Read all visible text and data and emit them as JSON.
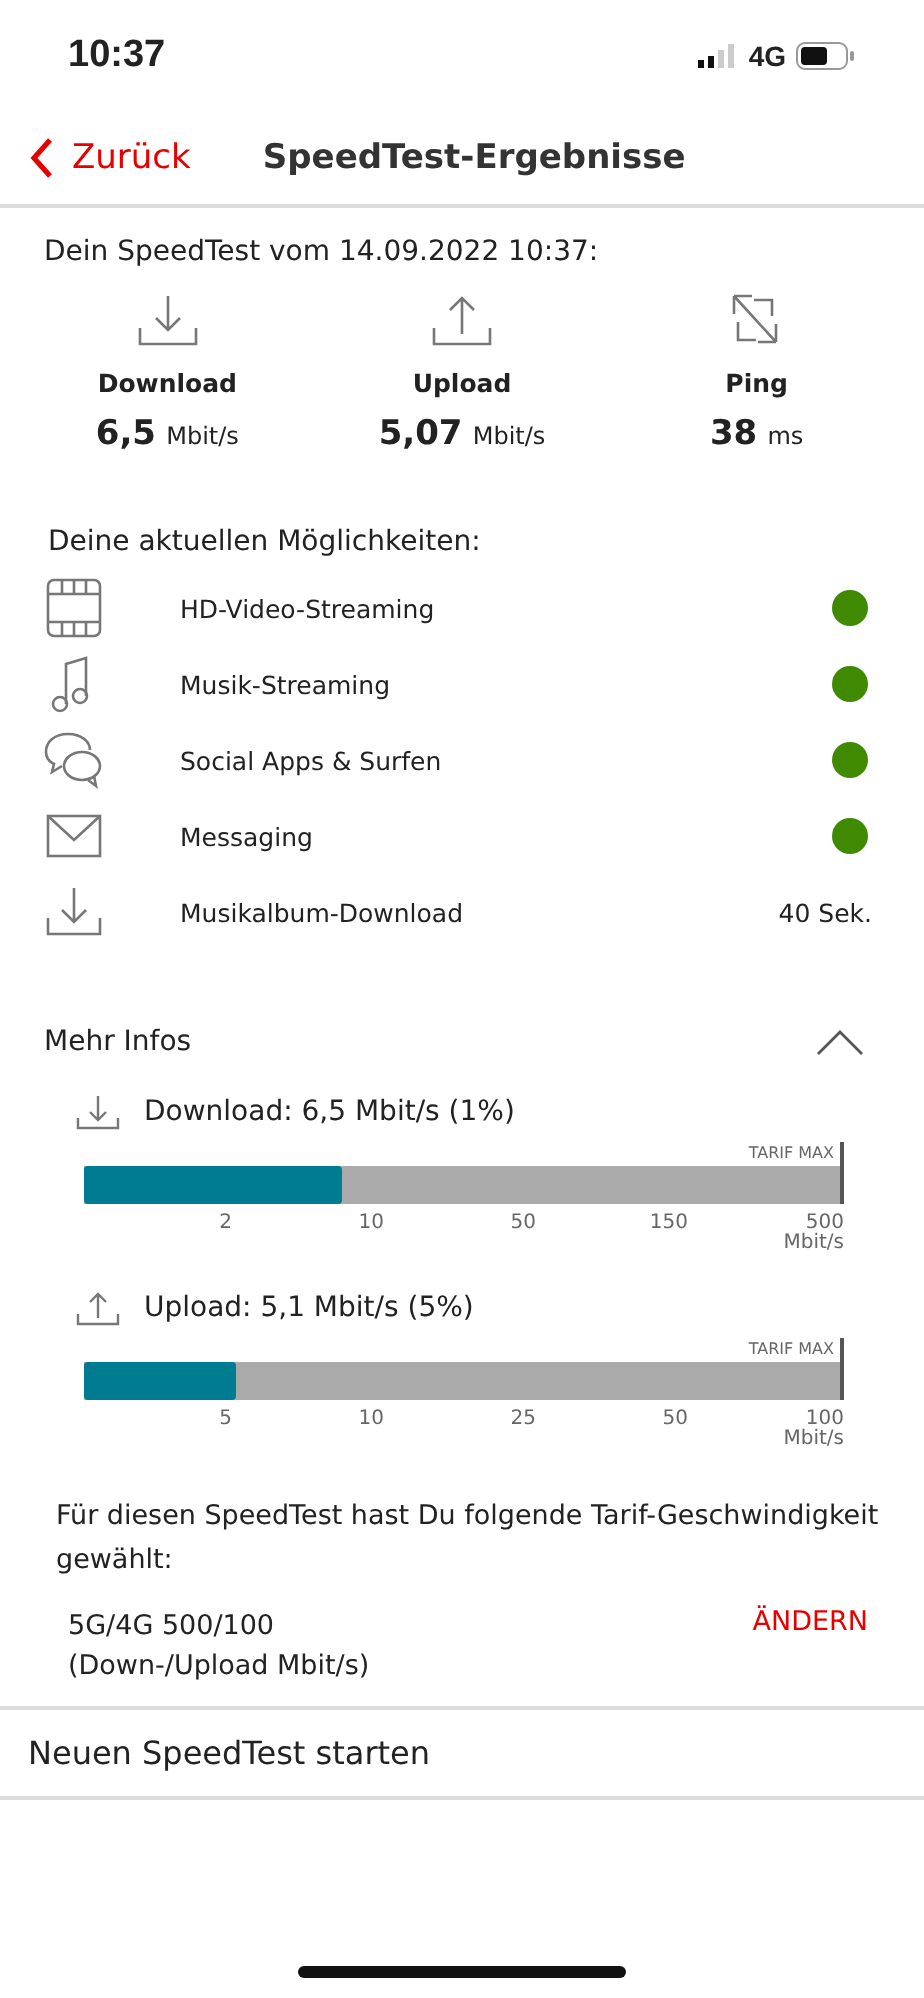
{
  "status_bar": {
    "time": "10:37",
    "network": "4G"
  },
  "nav": {
    "back": "Zurück",
    "title": "SpeedTest-Ergebnisse"
  },
  "summary": {
    "heading": "Dein SpeedTest vom 14.09.2022 10:37:",
    "metrics": [
      {
        "kind": "download",
        "label": "Download",
        "value": "6,5",
        "unit": "Mbit/s"
      },
      {
        "kind": "upload",
        "label": "Upload",
        "value": "5,07",
        "unit": "Mbit/s"
      },
      {
        "kind": "ping",
        "label": "Ping",
        "value": "38",
        "unit": "ms"
      }
    ]
  },
  "possibilities": {
    "heading": "Deine aktuellen Möglichkeiten:",
    "items": [
      {
        "kind": "video",
        "label": "HD-Video-Streaming",
        "color": "#3f8a00"
      },
      {
        "kind": "music",
        "label": "Musik-Streaming",
        "color": "#3f8a00"
      },
      {
        "kind": "chat",
        "label": "Social Apps & Surfen",
        "color": "#3f8a00"
      },
      {
        "kind": "mail",
        "label": "Messaging",
        "color": "#3f8a00"
      },
      {
        "kind": "download",
        "label": "Musikalbum-Download",
        "value": "40 Sek."
      }
    ]
  },
  "more_info": {
    "title": "Mehr Infos",
    "expanded": true,
    "bars": [
      {
        "kind": "download",
        "label": "Download: 6,5 Mbit/s (1%)",
        "max_label": "TARIF MAX",
        "level": 0.34,
        "ticks": [
          "2",
          "10",
          "50",
          "150",
          "500"
        ],
        "unit": "Mbit/s"
      },
      {
        "kind": "upload",
        "label": "Upload: 5,1 Mbit/s (5%)",
        "max_label": "TARIF MAX",
        "level": 0.2,
        "ticks": [
          "5",
          "10",
          "25",
          "50",
          "100"
        ],
        "unit": "Mbit/s"
      }
    ]
  },
  "tariff": {
    "text": "Für diesen SpeedTest hast Du folgende Tarif-Geschwindigkeit gewählt:",
    "plan": "5G/4G 500/100",
    "plan_note": "(Down-/Upload Mbit/s)",
    "action": "ÄNDERN"
  },
  "menu": [
    {
      "label": "Neuen SpeedTest starten"
    }
  ]
}
